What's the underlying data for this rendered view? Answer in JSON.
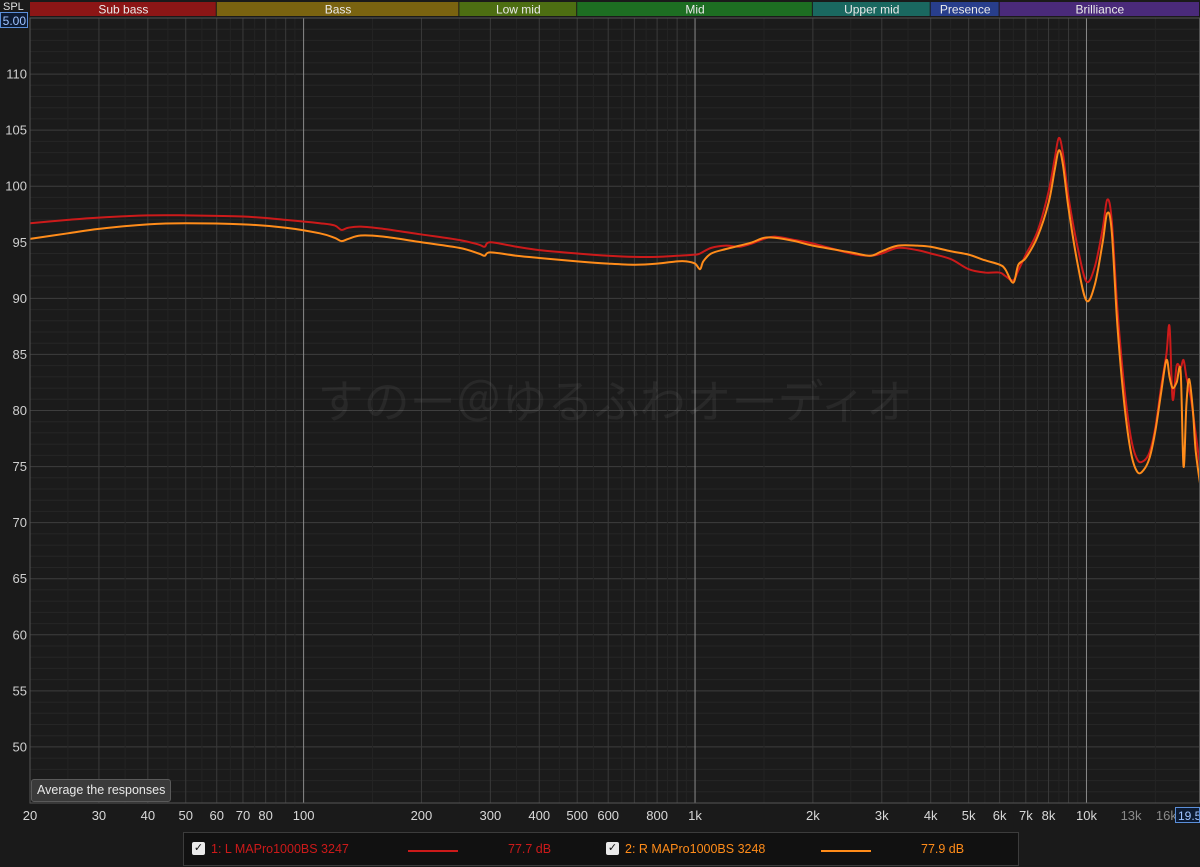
{
  "header": {
    "y_label": "SPL",
    "y_top_value": "5.00",
    "bands": [
      {
        "label": "Sub bass",
        "color": "#8c1616"
      },
      {
        "label": "Bass",
        "color": "#7a6310"
      },
      {
        "label": "Low mid",
        "color": "#4d6e12"
      },
      {
        "label": "Mid",
        "color": "#1d6e22"
      },
      {
        "label": "Upper mid",
        "color": "#1a6860"
      },
      {
        "label": "Presence",
        "color": "#283e8c"
      },
      {
        "label": "Brilliance",
        "color": "#4a2a7a"
      }
    ]
  },
  "x_end_value": "19.5",
  "watermark": "すのー＠ゆるふわオーディオ",
  "buttons": {
    "average": "Average the responses"
  },
  "legend": [
    {
      "index": "1:",
      "name": "L MAPro1000BS 3247",
      "value": "77.7 dB",
      "color": "#cc1a1a"
    },
    {
      "index": "2:",
      "name": "R MAPro1000BS 3248",
      "value": "77.9 dB",
      "color": "#ff8c1a"
    }
  ],
  "chart_data": {
    "type": "line",
    "xlabel": "",
    "ylabel": "SPL",
    "x_scale": "log",
    "xlim": [
      20,
      19500
    ],
    "ylim": [
      45,
      115
    ],
    "grid": true,
    "x_tick_labels": [
      {
        "value": 20,
        "label": "20"
      },
      {
        "value": 30,
        "label": "30"
      },
      {
        "value": 40,
        "label": "40"
      },
      {
        "value": 50,
        "label": "50"
      },
      {
        "value": 60,
        "label": "60"
      },
      {
        "value": 70,
        "label": "70"
      },
      {
        "value": 80,
        "label": "80"
      },
      {
        "value": 100,
        "label": "100"
      },
      {
        "value": 200,
        "label": "200"
      },
      {
        "value": 300,
        "label": "300"
      },
      {
        "value": 400,
        "label": "400"
      },
      {
        "value": 500,
        "label": "500"
      },
      {
        "value": 600,
        "label": "600"
      },
      {
        "value": 800,
        "label": "800"
      },
      {
        "value": 1000,
        "label": "1k"
      },
      {
        "value": 2000,
        "label": "2k"
      },
      {
        "value": 3000,
        "label": "3k"
      },
      {
        "value": 4000,
        "label": "4k"
      },
      {
        "value": 5000,
        "label": "5k"
      },
      {
        "value": 6000,
        "label": "6k"
      },
      {
        "value": 7000,
        "label": "7k"
      },
      {
        "value": 8000,
        "label": "8k"
      },
      {
        "value": 10000,
        "label": "10k"
      },
      {
        "value": 13000,
        "label": "13k"
      },
      {
        "value": 16000,
        "label": "16k"
      }
    ],
    "y_ticks": [
      50,
      55,
      60,
      65,
      70,
      75,
      80,
      85,
      90,
      95,
      100,
      105,
      110
    ],
    "series": [
      {
        "name": "L MAPro1000BS 3247",
        "color": "#cc1a1a",
        "points": [
          [
            20,
            96.7
          ],
          [
            25,
            97.0
          ],
          [
            30,
            97.2
          ],
          [
            40,
            97.4
          ],
          [
            50,
            97.4
          ],
          [
            70,
            97.3
          ],
          [
            90,
            97.0
          ],
          [
            110,
            96.7
          ],
          [
            120,
            96.5
          ],
          [
            125,
            96.1
          ],
          [
            130,
            96.3
          ],
          [
            140,
            96.4
          ],
          [
            160,
            96.2
          ],
          [
            200,
            95.7
          ],
          [
            250,
            95.2
          ],
          [
            280,
            94.8
          ],
          [
            290,
            94.6
          ],
          [
            300,
            95.0
          ],
          [
            350,
            94.6
          ],
          [
            400,
            94.3
          ],
          [
            500,
            94.0
          ],
          [
            600,
            93.8
          ],
          [
            700,
            93.7
          ],
          [
            800,
            93.7
          ],
          [
            900,
            93.8
          ],
          [
            1000,
            93.9
          ],
          [
            1030,
            94.0
          ],
          [
            1100,
            94.5
          ],
          [
            1200,
            94.7
          ],
          [
            1300,
            94.6
          ],
          [
            1400,
            94.9
          ],
          [
            1500,
            95.3
          ],
          [
            1600,
            95.5
          ],
          [
            1800,
            95.2
          ],
          [
            2000,
            94.9
          ],
          [
            2500,
            94.0
          ],
          [
            2800,
            93.8
          ],
          [
            3000,
            94.0
          ],
          [
            3300,
            94.5
          ],
          [
            3700,
            94.3
          ],
          [
            4000,
            94.0
          ],
          [
            4500,
            93.5
          ],
          [
            5000,
            92.6
          ],
          [
            5500,
            92.3
          ],
          [
            6000,
            92.3
          ],
          [
            6200,
            92.0
          ],
          [
            6500,
            91.6
          ],
          [
            6700,
            92.5
          ],
          [
            7000,
            93.9
          ],
          [
            7500,
            96.0
          ],
          [
            8000,
            99.5
          ],
          [
            8300,
            102.5
          ],
          [
            8500,
            104.3
          ],
          [
            8700,
            103.0
          ],
          [
            9000,
            99.0
          ],
          [
            9500,
            94.5
          ],
          [
            10000,
            91.5
          ],
          [
            10500,
            92.8
          ],
          [
            11000,
            96.2
          ],
          [
            11300,
            98.8
          ],
          [
            11600,
            97.0
          ],
          [
            12000,
            89.0
          ],
          [
            12500,
            82.0
          ],
          [
            13000,
            77.5
          ],
          [
            13500,
            75.6
          ],
          [
            14000,
            75.5
          ],
          [
            14500,
            76.3
          ],
          [
            15000,
            78.5
          ],
          [
            15500,
            82.0
          ],
          [
            16000,
            85.0
          ],
          [
            16300,
            87.5
          ],
          [
            16600,
            81.0
          ],
          [
            17000,
            84.0
          ],
          [
            17400,
            83.8
          ],
          [
            17700,
            84.5
          ],
          [
            18000,
            83.0
          ],
          [
            18500,
            81.0
          ],
          [
            19000,
            78.0
          ],
          [
            19500,
            75.0
          ]
        ]
      },
      {
        "name": "R MAPro1000BS 3248",
        "color": "#ff8c1a",
        "points": [
          [
            20,
            95.3
          ],
          [
            25,
            95.8
          ],
          [
            30,
            96.2
          ],
          [
            40,
            96.6
          ],
          [
            50,
            96.7
          ],
          [
            70,
            96.6
          ],
          [
            90,
            96.3
          ],
          [
            110,
            95.8
          ],
          [
            120,
            95.4
          ],
          [
            125,
            95.1
          ],
          [
            130,
            95.3
          ],
          [
            140,
            95.6
          ],
          [
            160,
            95.5
          ],
          [
            200,
            95.0
          ],
          [
            250,
            94.5
          ],
          [
            280,
            94.0
          ],
          [
            290,
            93.8
          ],
          [
            300,
            94.1
          ],
          [
            350,
            93.8
          ],
          [
            400,
            93.6
          ],
          [
            500,
            93.3
          ],
          [
            600,
            93.1
          ],
          [
            700,
            93.0
          ],
          [
            800,
            93.1
          ],
          [
            900,
            93.3
          ],
          [
            950,
            93.3
          ],
          [
            1000,
            93.1
          ],
          [
            1030,
            92.6
          ],
          [
            1050,
            93.3
          ],
          [
            1100,
            94.0
          ],
          [
            1200,
            94.4
          ],
          [
            1300,
            94.7
          ],
          [
            1400,
            95.0
          ],
          [
            1500,
            95.4
          ],
          [
            1600,
            95.4
          ],
          [
            1800,
            95.1
          ],
          [
            2000,
            94.7
          ],
          [
            2500,
            94.1
          ],
          [
            2800,
            93.8
          ],
          [
            3000,
            94.2
          ],
          [
            3300,
            94.7
          ],
          [
            3700,
            94.7
          ],
          [
            4000,
            94.6
          ],
          [
            4500,
            94.2
          ],
          [
            5000,
            93.9
          ],
          [
            5500,
            93.4
          ],
          [
            6000,
            93.0
          ],
          [
            6200,
            92.6
          ],
          [
            6500,
            91.4
          ],
          [
            6700,
            93.0
          ],
          [
            7000,
            93.6
          ],
          [
            7500,
            95.5
          ],
          [
            8000,
            98.5
          ],
          [
            8300,
            101.5
          ],
          [
            8500,
            103.2
          ],
          [
            8700,
            102.0
          ],
          [
            9000,
            98.0
          ],
          [
            9500,
            93.0
          ],
          [
            10000,
            89.8
          ],
          [
            10500,
            91.2
          ],
          [
            11000,
            95.0
          ],
          [
            11300,
            97.6
          ],
          [
            11600,
            96.0
          ],
          [
            12000,
            87.5
          ],
          [
            12500,
            80.5
          ],
          [
            13000,
            76.2
          ],
          [
            13500,
            74.5
          ],
          [
            14000,
            74.7
          ],
          [
            14500,
            75.8
          ],
          [
            15000,
            78.2
          ],
          [
            15500,
            81.5
          ],
          [
            16000,
            84.5
          ],
          [
            16300,
            83.0
          ],
          [
            16600,
            82.0
          ],
          [
            17000,
            82.5
          ],
          [
            17400,
            83.5
          ],
          [
            17700,
            75.0
          ],
          [
            18000,
            80.5
          ],
          [
            18300,
            82.8
          ],
          [
            18700,
            80.0
          ],
          [
            19000,
            76.5
          ],
          [
            19500,
            73.5
          ]
        ]
      }
    ]
  }
}
